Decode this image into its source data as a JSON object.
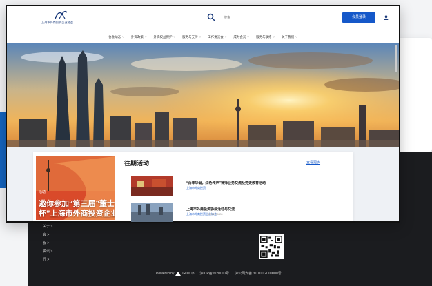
{
  "header": {
    "logo_text": "上海市外商投资企业协会",
    "search_hint": "搜索",
    "primary_button": "会员登录"
  },
  "nav": [
    {
      "label": "协会动态"
    },
    {
      "label": "外资政策"
    },
    {
      "label": "外资权益保护"
    },
    {
      "label": "服务与支持"
    },
    {
      "label": "工作委员会"
    },
    {
      "label": "成为会员"
    },
    {
      "label": "服务与联络"
    },
    {
      "label": "关于我们"
    }
  ],
  "promo": {
    "tag": "活动",
    "title_line1": "邀你参加“第三届”董士",
    "title_line2": "杯”上海市外商投资企业"
  },
  "section": {
    "title": "往期活动",
    "more": "查看更多"
  },
  "events": [
    {
      "title": "“百年华诞，红色传声”律师业务交流及党史教育活动",
      "date": "上海市外商投资",
      "sub": ""
    },
    {
      "title": "上海市外商投资协会活动与交流",
      "date": "上海市外商投资企业协会",
      "sub": "2021-05-28"
    }
  ],
  "footer": {
    "links": [
      "关于 >",
      "会 >",
      "服 >",
      "资讯 >",
      "行 >"
    ],
    "powered_prefix": "Powered by",
    "powered_brand": "GlueUp",
    "icp": "沪ICP备2020000号",
    "police": "沪公网安备 3101012000000号"
  }
}
